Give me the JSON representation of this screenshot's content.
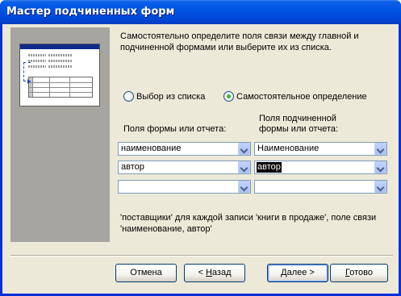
{
  "window": {
    "title": "Мастер подчиненных форм"
  },
  "description": "Самостоятельно определите поля связи между главной и подчиненной формами или выберите их из списка.",
  "options": {
    "choose_from_list": "Выбор из списка",
    "define_myself": "Самостоятельное определение",
    "selected": "define_myself"
  },
  "columns": {
    "main_header": "Поля формы или отчета:",
    "sub_header_line1": "Поля подчиненной",
    "sub_header_line2": "формы или отчета:"
  },
  "fields": {
    "main": [
      "наименование",
      "автор",
      ""
    ],
    "sub": [
      "Наименование",
      "автор",
      ""
    ]
  },
  "status_text": "'поставщики' для каждой записи 'книги в продаже', поле связи 'наименование, автор'",
  "buttons": {
    "cancel": "Отмена",
    "back_prefix": "< ",
    "back_hotkey": "Н",
    "back_rest": "азад",
    "next_prefix": "",
    "next_hotkey": "Д",
    "next_rest": "алее >",
    "finish_prefix": "",
    "finish_hotkey": "Г",
    "finish_rest": "отово"
  },
  "colors": {
    "titlebar": "#0054e3",
    "dialog_bg": "#ece9d8",
    "illustration_bg": "#a6a5a0",
    "selection": "#000000"
  }
}
